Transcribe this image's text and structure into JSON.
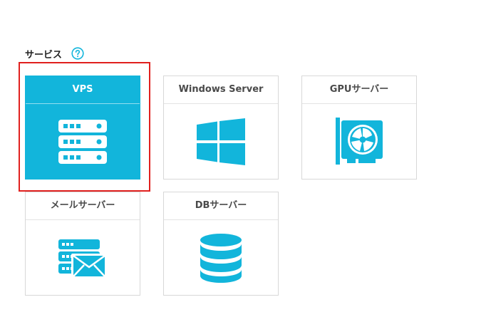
{
  "section": {
    "title": "サービス",
    "help_icon": "question-circle-icon"
  },
  "colors": {
    "accent": "#12b5db",
    "selection_border": "#e0201e",
    "card_border": "#d8d8d8"
  },
  "services": [
    {
      "label": "VPS",
      "icon": "server-stack-icon",
      "selected": true
    },
    {
      "label": "Windows Server",
      "icon": "windows-logo-icon",
      "selected": false
    },
    {
      "label": "GPUサーバー",
      "icon": "gpu-card-icon",
      "selected": false
    },
    {
      "label": "メールサーバー",
      "icon": "mail-server-icon",
      "selected": false
    },
    {
      "label": "DBサーバー",
      "icon": "database-icon",
      "selected": false
    }
  ]
}
